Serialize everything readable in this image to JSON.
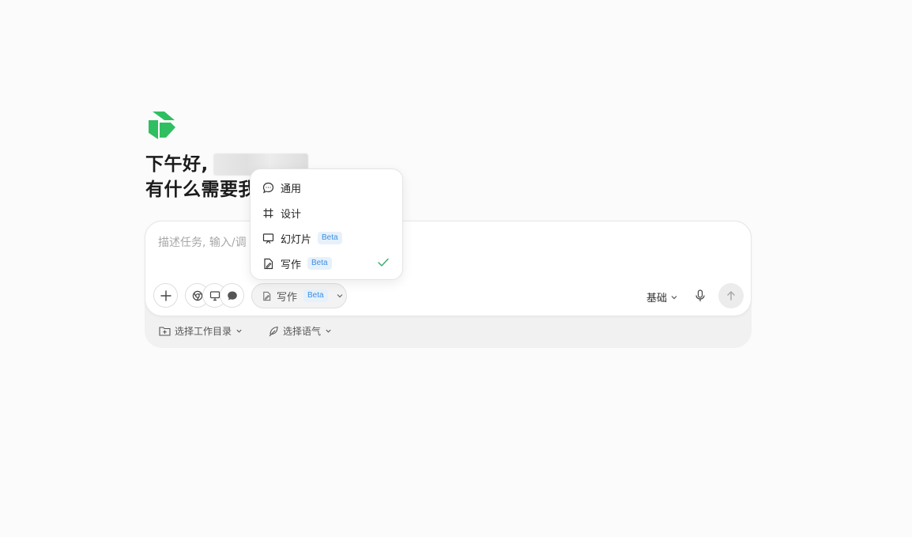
{
  "greeting": {
    "line1": "下午好,",
    "line2": "有什么需要我"
  },
  "composer": {
    "placeholder": "描述任务, 输入/调",
    "mode_label": "写作",
    "mode_badge": "Beta",
    "model_label": "基础"
  },
  "bottom_bar": {
    "workdir_label": "选择工作目录",
    "tone_label": "选择语气"
  },
  "dropdown": {
    "items": [
      {
        "label": "通用",
        "icon": "chat-bubble-icon",
        "badge": "",
        "selected": false
      },
      {
        "label": "设计",
        "icon": "hash-frame-icon",
        "badge": "",
        "selected": false
      },
      {
        "label": "幻灯片",
        "icon": "presentation-icon",
        "badge": "Beta",
        "selected": false
      },
      {
        "label": "写作",
        "icon": "document-edit-icon",
        "badge": "Beta",
        "selected": true
      }
    ]
  },
  "colors": {
    "brand_green": "#2fbf61",
    "beta_blue": "#3d8ee0",
    "check_green": "#3aa86b"
  }
}
